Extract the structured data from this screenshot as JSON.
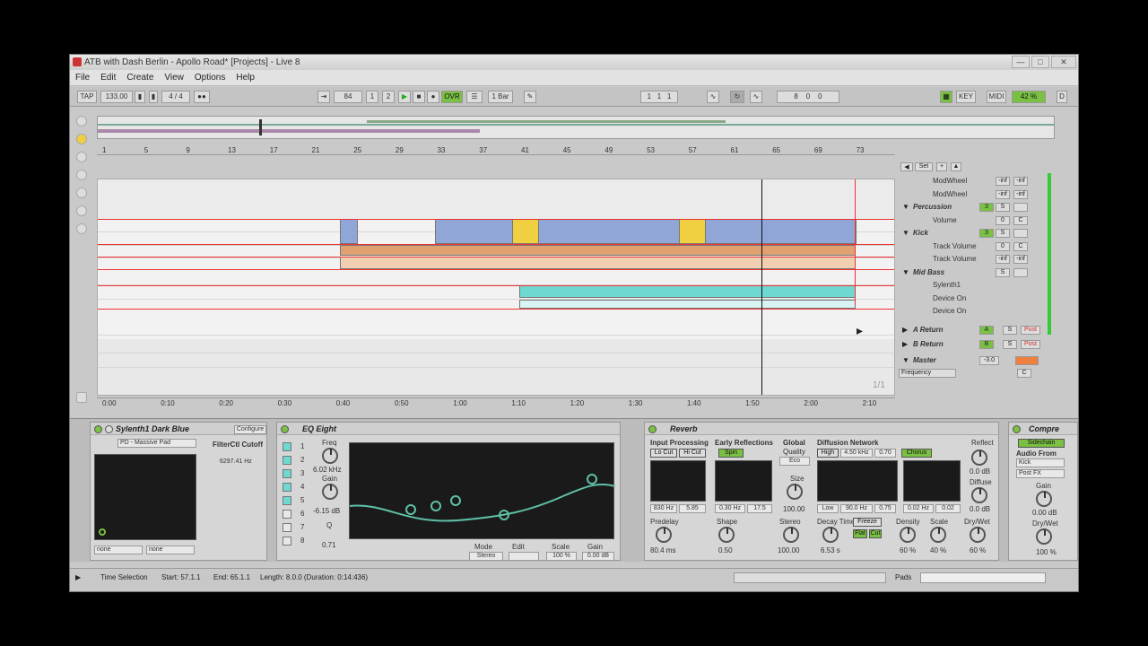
{
  "window": {
    "title": "ATB with Dash Berlin - Apollo Road*  [Projects] - Live 8"
  },
  "menu": [
    "File",
    "Edit",
    "Create",
    "View",
    "Options",
    "Help"
  ],
  "transport": {
    "tap": "TAP",
    "tempo": "133.00",
    "signature": "4 / 4",
    "position_bar": "84",
    "position_beat": "1",
    "position_sixteenth": "2",
    "ovr": "OVR",
    "quantize": "1 Bar",
    "loop_start": [
      "1",
      "1",
      "1"
    ],
    "loop_length": [
      "8",
      "0",
      "0"
    ],
    "key": "KEY",
    "midi": "MIDI",
    "cpu": "42 %",
    "d": "D"
  },
  "ruler": {
    "bars": [
      "1",
      "5",
      "9",
      "13",
      "17",
      "21",
      "25",
      "29",
      "33",
      "37",
      "41",
      "45",
      "49",
      "53",
      "57",
      "61",
      "65",
      "69",
      "73"
    ]
  },
  "time_ruler": {
    "times": [
      "0:00",
      "0:10",
      "0:20",
      "0:30",
      "0:40",
      "0:50",
      "1:00",
      "1:10",
      "1:20",
      "1:30",
      "1:40",
      "1:50",
      "2:00",
      "2:10"
    ]
  },
  "page_counter": "1/1",
  "mixer": {
    "set_label": "Set",
    "tracks": [
      {
        "name": "",
        "param": "ModWheel",
        "vals": [
          "-inf",
          "-inf"
        ]
      },
      {
        "name": "",
        "param": "ModWheel",
        "vals": [
          "-inf",
          "-inf"
        ]
      },
      {
        "name": "Percussion",
        "param": "",
        "num": "3",
        "vals": [
          "S",
          ""
        ]
      },
      {
        "name": "",
        "param": "Volume",
        "vals": [
          "0",
          "C"
        ]
      },
      {
        "name": "Kick",
        "param": "",
        "num": "3",
        "vals": [
          "S",
          ""
        ]
      },
      {
        "name": "",
        "param": "Track Volume",
        "vals": [
          "0",
          "C"
        ]
      },
      {
        "name": "",
        "param": "Track Volume",
        "vals": [
          "-inf",
          "-inf"
        ]
      },
      {
        "name": "Mid Bass",
        "param": "",
        "vals": [
          "S",
          ""
        ]
      },
      {
        "name": "",
        "param": "Sylenth1",
        "vals": [
          "",
          ""
        ]
      },
      {
        "name": "",
        "param": "Device On",
        "vals": [
          "",
          ""
        ]
      },
      {
        "name": "",
        "param": "Device On",
        "vals": [
          "",
          ""
        ]
      }
    ],
    "returns": [
      {
        "name": "A Return",
        "letter": "A",
        "s": "S",
        "post": "Post"
      },
      {
        "name": "B Return",
        "letter": "B",
        "s": "S",
        "post": "Post"
      }
    ],
    "master": {
      "name": "Master",
      "val": "-3.0",
      "c": "C",
      "param": "Frequency"
    }
  },
  "devices": {
    "sylenth": {
      "title": "Sylenth1 Dark Blue",
      "configure": "Configure",
      "preset": "PD - Massive Pad",
      "param_label": "FilterCtl Cutoff",
      "param_value": "6297.41 Hz",
      "sel1": "none",
      "sel2": "none"
    },
    "eq": {
      "title": "EQ Eight",
      "bands": [
        "1",
        "2",
        "3",
        "4",
        "5",
        "6",
        "7",
        "8"
      ],
      "freq_label": "Freq",
      "freq_value": "6.02 kHz",
      "gain_label": "Gain",
      "gain_value": "-6.15 dB",
      "q_label": "Q",
      "q_value": "0.71",
      "mode_label": "Mode",
      "mode_value": "Stereo",
      "edit_label": "Edit",
      "scale_label": "Scale",
      "scale_value": "100 %",
      "out_gain_label": "Gain",
      "out_gain_value": "0.00 dB"
    },
    "reverb": {
      "title": "Reverb",
      "input_processing": "Input Processing",
      "lo_cut": "Lo Cut",
      "hi_cut": "Hi Cut",
      "early_reflections": "Early Reflections",
      "spin": "Spin",
      "global": "Global",
      "quality": "Quality",
      "eco": "Eco",
      "diffusion_network": "Diffusion Network",
      "high": "High",
      "high_freq": "4.50 kHz",
      "high_val": "0.70",
      "chorus": "Chorus",
      "reflect": "Reflect",
      "reflect_val": "0.0 dB",
      "input_vals": [
        "830 Hz",
        "5.85"
      ],
      "er_vals": [
        "0.30 Hz",
        "17.5"
      ],
      "size_label": "Size",
      "size_val": "100.00",
      "diff_vals": [
        "Low",
        "90.0 Hz",
        "0.75"
      ],
      "chorus_vals": [
        "0.02 Hz",
        "0.02"
      ],
      "diffuse_label": "Diffuse",
      "diffuse_val": "0.0 dB",
      "predelay_label": "Predelay",
      "predelay_val": "80.4 ms",
      "shape_label": "Shape",
      "shape_val": "0.50",
      "stereo_label": "Stereo",
      "stereo_val": "100.00",
      "decay_label": "Decay Time",
      "decay_val": "6.53 s",
      "freeze": "Freeze",
      "flat": "Flat",
      "cut": "Cut",
      "density_label": "Density",
      "density_val": "60 %",
      "scale_label": "Scale",
      "scale_val": "40 %",
      "drywet_label": "Dry/Wet",
      "drywet_val": "60 %",
      "chorus_vertical": "Chorus"
    },
    "compressor": {
      "title": "Compre",
      "sidechain": "Sidechain",
      "audio_from": "Audio From",
      "source": "Kick",
      "tap": "Post FX",
      "gain_label": "Gain",
      "gain_val": "0.00 dB",
      "drywet_label": "Dry/Wet",
      "drywet_val": "100 %"
    }
  },
  "status": {
    "label": "Time Selection",
    "start": "Start: 57.1.1",
    "end": "End: 65.1.1",
    "length": "Length: 8.0.0  (Duration: 0:14:436)",
    "pads": "Pads"
  },
  "colors": {
    "accent_green": "#7ac043",
    "automation_red": "#e33333",
    "clip_blue": "#8fa6d6",
    "clip_yellow": "#f0d040",
    "clip_orange": "#e0a070",
    "clip_cyan": "#6fd8d0"
  }
}
